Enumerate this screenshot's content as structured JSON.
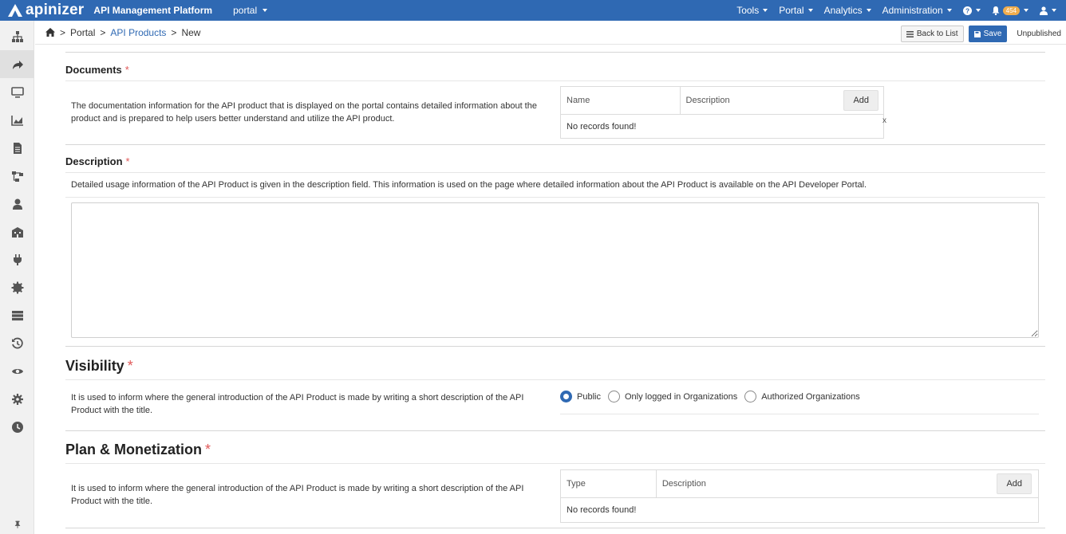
{
  "app": {
    "brand": "apinizer",
    "platform": "API Management Platform",
    "project": "portal",
    "nav": [
      "Tools",
      "Portal",
      "Analytics",
      "Administration"
    ],
    "notification_count": "454"
  },
  "breadcrumb": {
    "items": [
      "Portal",
      "API Products",
      "New"
    ]
  },
  "toolbar": {
    "back_label": "Back to List",
    "save_label": "Save",
    "status": "Unpublished"
  },
  "documents": {
    "title": "Documents",
    "required": "*",
    "description": "The documentation information for the API product that is displayed on the portal contains detailed information about the product and is prepared to help users better understand and utilize the API product.",
    "columns": [
      "Name",
      "Description"
    ],
    "add_label": "Add",
    "empty": "No records found!",
    "close": "x"
  },
  "description_section": {
    "title": "Description",
    "required": "*",
    "description": "Detailed usage information of the API Product is given in the description field. This information is used on the page where detailed information about the API Product is available on the API Developer Portal.",
    "value": ""
  },
  "visibility": {
    "title": "Visibility",
    "required": "*",
    "description": "It is used to inform where the general introduction of the API Product is made by writing a short description of the API Product with the title.",
    "options": [
      "Public",
      "Only logged in Organizations",
      "Authorized Organizations"
    ],
    "selected": "Public"
  },
  "plan": {
    "title": "Plan & Monetization",
    "required": "*",
    "description": "It is used to inform where the general introduction of the API Product is made by writing a short description of the API Product with the title.",
    "columns": [
      "Type",
      "Description"
    ],
    "add_label": "Add",
    "empty": "No records found!"
  },
  "colors": {
    "primary": "#2f69b3",
    "required": "#e05858",
    "badge": "#f0ad4e"
  },
  "icons": [
    "home-icon",
    "sitemap-icon",
    "share-icon",
    "monitor-icon",
    "chart-icon",
    "file-icon",
    "flow-icon",
    "user-icon",
    "building-icon",
    "plug-icon",
    "gear-badge-icon",
    "server-icon",
    "history-icon",
    "eye-icon",
    "cog-icon",
    "clock-icon",
    "pin-icon",
    "help-icon",
    "bell-icon",
    "account-icon",
    "save-icon",
    "list-icon"
  ]
}
